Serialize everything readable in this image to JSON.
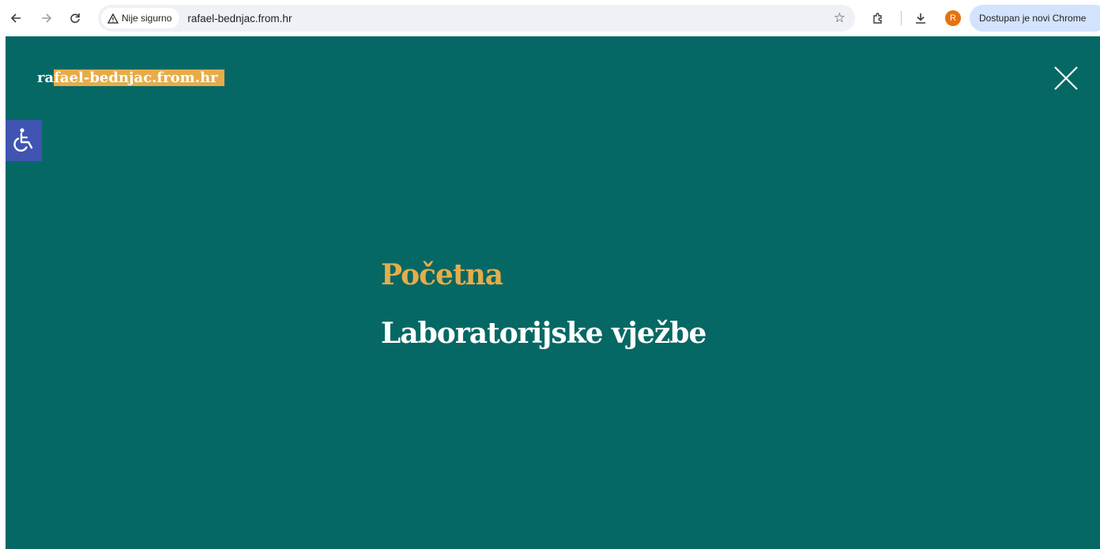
{
  "browser": {
    "security_label": "Nije sigurno",
    "url": "rafael-bednjac.from.hr",
    "profile_initial": "R",
    "update_label": "Dostupan je novi Chrome"
  },
  "site": {
    "title_prefix": "ra",
    "title_highlight": "fael-bednjac.from.hr"
  },
  "menu": {
    "items": [
      {
        "label": "Početna",
        "active": true
      },
      {
        "label": "Laboratorijske vježbe",
        "active": false
      }
    ]
  },
  "colors": {
    "page_bg": "#066864",
    "accent": "#e6ac4a",
    "a11y_bg": "#4054b2"
  },
  "icons": [
    "back-arrow-icon",
    "forward-arrow-icon",
    "reload-icon",
    "warning-icon",
    "star-icon",
    "extensions-icon",
    "download-icon",
    "close-icon",
    "wheelchair-icon"
  ]
}
